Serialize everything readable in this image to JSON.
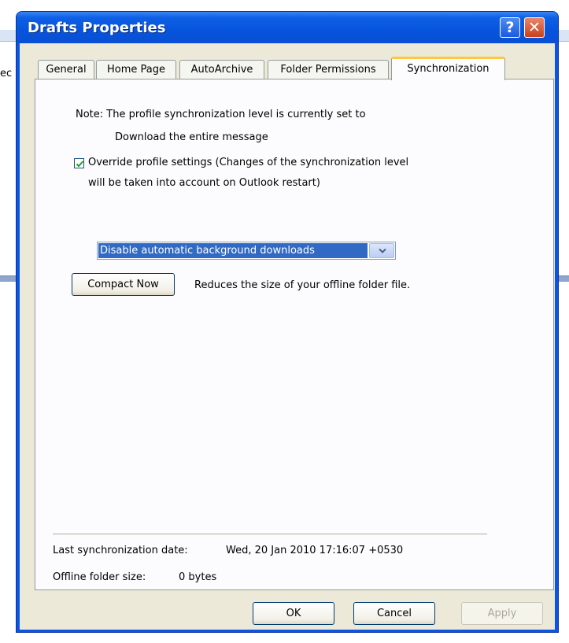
{
  "background": {
    "fragment_text": "ec"
  },
  "window": {
    "title": "Drafts Properties",
    "help_glyph": "?",
    "close_glyph": "✕"
  },
  "tabs": [
    {
      "label": "General"
    },
    {
      "label": "Home Page"
    },
    {
      "label": "AutoArchive"
    },
    {
      "label": "Folder Permissions"
    },
    {
      "label": "Synchronization",
      "active": true
    }
  ],
  "sync": {
    "note_line1": "Note: The profile synchronization level is currently set to",
    "note_line2": "Download the entire message",
    "override_checked": true,
    "override_line1": "Override profile settings (Changes of the synchronization level",
    "override_line2": "will be taken into account on Outlook restart)",
    "dropdown_value": "Disable automatic background downloads",
    "compact_button": "Compact Now",
    "compact_desc": "Reduces the size of your offline folder file.",
    "last_sync_label": "Last synchronization date:",
    "last_sync_value": "Wed, 20 Jan 2010 17:16:07 +0530",
    "offline_size_label": "Offline folder size:",
    "offline_size_value": "0 bytes"
  },
  "buttons": {
    "ok": "OK",
    "cancel": "Cancel",
    "apply": "Apply",
    "apply_enabled": false
  },
  "colors": {
    "title_bar": "#0a55e2",
    "selection": "#316ac5",
    "dialog_face": "#ece9d8",
    "tab_highlight": "#ffc83c"
  }
}
